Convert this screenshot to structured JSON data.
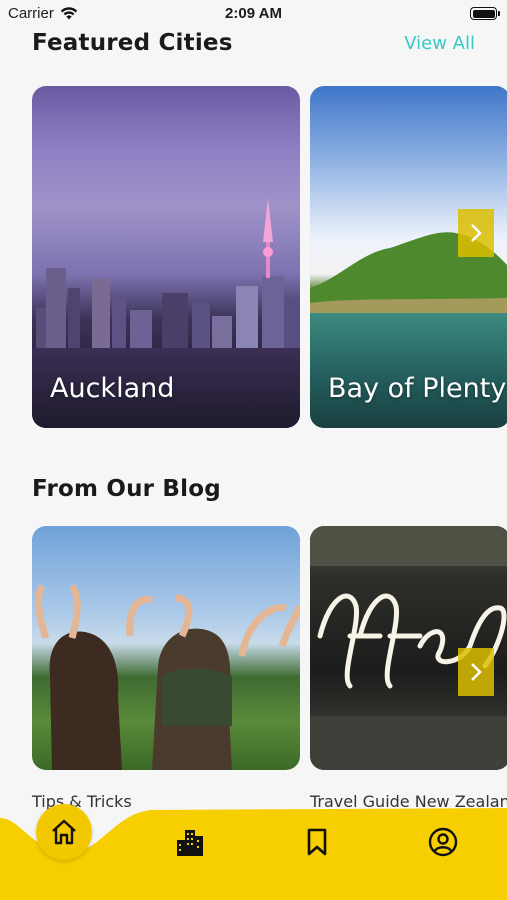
{
  "status_bar": {
    "carrier": "Carrier",
    "time": "2:09 AM"
  },
  "featured": {
    "title": "Featured Cities",
    "view_all": "View All",
    "cities": [
      {
        "name": "Auckland"
      },
      {
        "name": "Bay of Plenty"
      }
    ]
  },
  "blog": {
    "title": "From Our Blog",
    "posts": [
      {
        "title": "Tips & Tricks"
      },
      {
        "title": "Travel Guide New Zealand"
      }
    ]
  },
  "nav": {
    "items": [
      {
        "icon": "home-icon",
        "active": true
      },
      {
        "icon": "city-icon",
        "active": false
      },
      {
        "icon": "bookmark-icon",
        "active": false
      },
      {
        "icon": "profile-icon",
        "active": false
      }
    ]
  },
  "colors": {
    "accent": "#f7cf00",
    "link": "#37c9c9",
    "background": "#f6f6f6"
  }
}
